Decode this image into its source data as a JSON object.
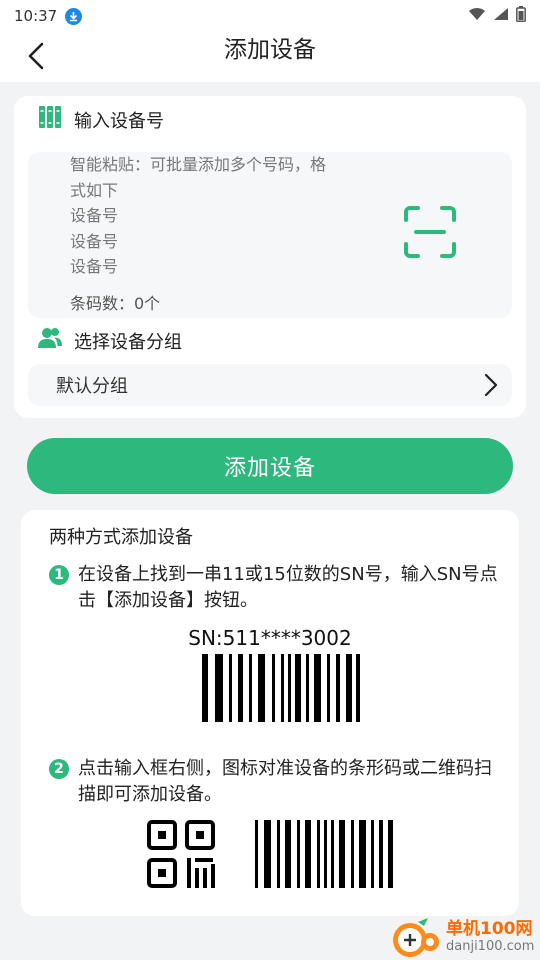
{
  "status_bar": {
    "time": "10:37"
  },
  "header": {
    "title": "添加设备"
  },
  "device_input": {
    "section_label": "输入设备号",
    "placeholder_lines": [
      "智能粘贴：可批量添加多个号码，格",
      "式如下",
      "设备号",
      "设备号",
      "设备号"
    ],
    "count_label": "条码数：0个"
  },
  "group_select": {
    "section_label": "选择设备分组",
    "selected_value": "默认分组"
  },
  "primary_button": {
    "label": "添加设备"
  },
  "instructions": {
    "title": "两种方式添加设备",
    "steps": [
      {
        "number": "1",
        "text": "在设备上找到一串11或15位数的SN号，输入SN号点击【添加设备】按钮。"
      },
      {
        "number": "2",
        "text": "点击输入框右侧，图标对准设备的条形码或二维码扫描即可添加设备。"
      }
    ],
    "sn_example": "SN:511****3002"
  },
  "watermark": {
    "name": "单机100网",
    "domain": "danji100.com"
  },
  "colors": {
    "accent": "#2db87d",
    "background": "#f2f3f5",
    "card": "#ffffff"
  }
}
